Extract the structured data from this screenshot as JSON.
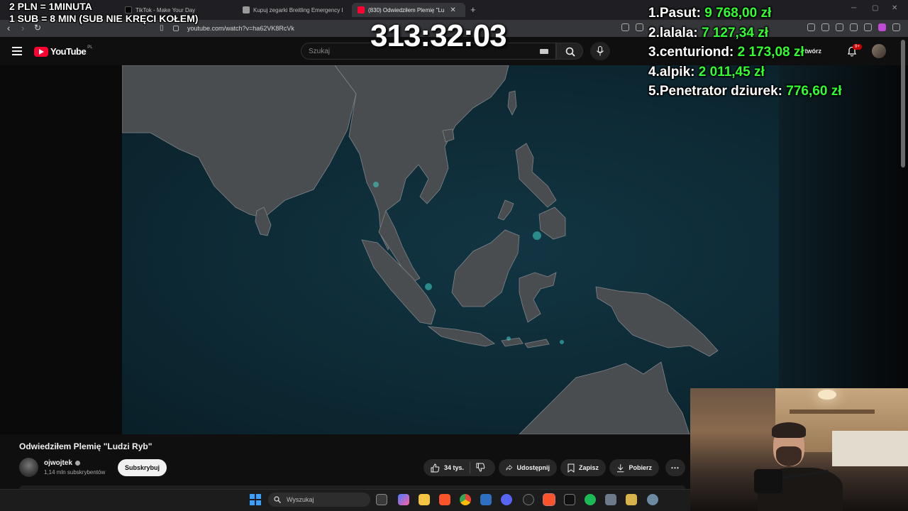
{
  "overlay": {
    "rate_line1": "2 PLN =  1MINUTA",
    "rate_line2": "1 SUB = 8 MIN (SUB NIE KRĘCI KOŁEM)",
    "timer": "313:32:03",
    "leaderboard": [
      {
        "rank": "1.",
        "name": "Pasut:",
        "amount": "9 768,00 zł"
      },
      {
        "rank": "2.",
        "name": "lalala:",
        "amount": "7 127,34 zł"
      },
      {
        "rank": "3.",
        "name": "centuriond:",
        "amount": "2 173,08 zł"
      },
      {
        "rank": "4.",
        "name": "alpik:",
        "amount": "2 011,45 zł"
      },
      {
        "rank": "5.",
        "name": "Penetrator dziurek:",
        "amount": "776,60 zł"
      }
    ],
    "amount_color": "#30ff30"
  },
  "browser": {
    "tabs": [
      {
        "title": "TikTok - Make Your Day",
        "icon": "tiktok-icon"
      },
      {
        "title": "Kupuj zegarki Breitling Emergency II",
        "icon": "page-icon"
      },
      {
        "title": "(830) Odwiedziłem Plemię \"Lu",
        "icon": "youtube-icon",
        "active": true
      }
    ],
    "url": "youtube.com/watch?v=ha62VK8RcVk"
  },
  "youtube": {
    "logo_text": "YouTube",
    "region": "PL",
    "search_placeholder": "Szukaj",
    "create_label": "Utwórz",
    "notifications_badge": "9+",
    "video_title": "Odwiedziłem Plemię \"Ludzi Ryb\"",
    "channel_name": "ojwojtek",
    "channel_subs": "1,14 mln subskrybentów",
    "subscribe_label": "Subskrybuj",
    "likes": "34 tys.",
    "share_label": "Udostępnij",
    "save_label": "Zapisz",
    "download_label": "Pobierz",
    "brand_color": "#ff0033"
  },
  "taskbar": {
    "search_placeholder": "Wyszukaj"
  }
}
